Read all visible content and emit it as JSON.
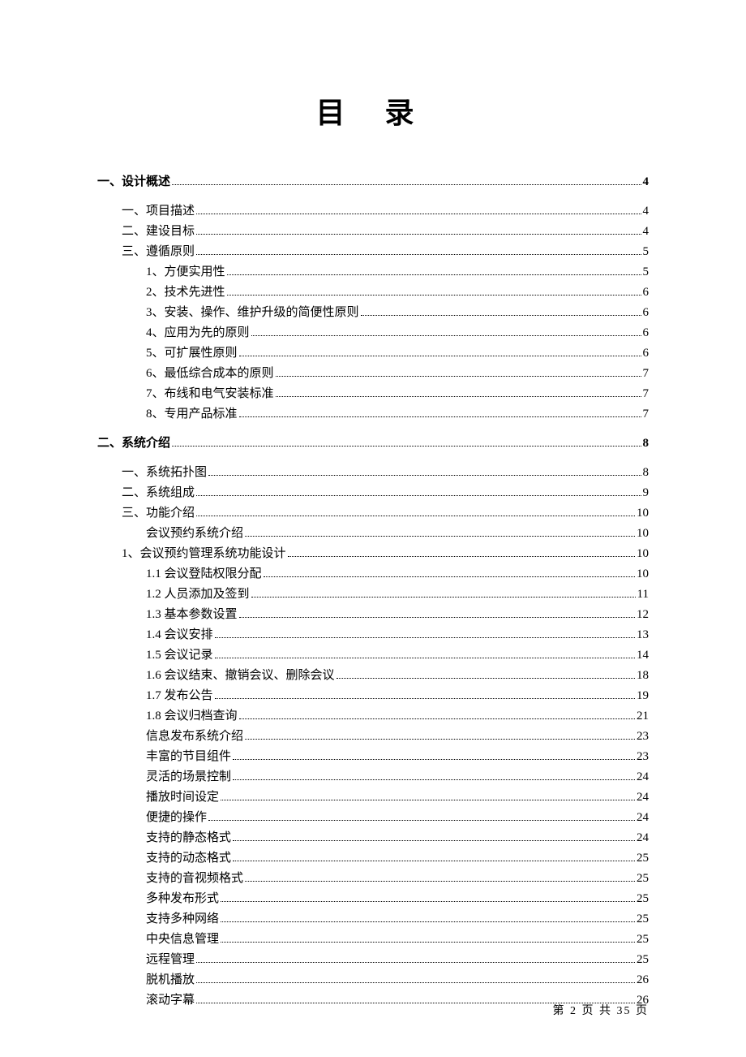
{
  "title": "目 录",
  "footer": {
    "prefix": "第",
    "page": "2",
    "middle": "页 共",
    "total": "35",
    "suffix": "页"
  },
  "toc": [
    {
      "label": "一、设计概述",
      "page": "4",
      "indent": 0,
      "bold": true,
      "gap": false
    },
    {
      "label": "一、项目描述",
      "page": "4",
      "indent": 1,
      "bold": false,
      "gap": true
    },
    {
      "label": "二、建设目标",
      "page": "4",
      "indent": 1,
      "bold": false,
      "gap": false
    },
    {
      "label": "三、遵循原则",
      "page": "5",
      "indent": 1,
      "bold": false,
      "gap": false
    },
    {
      "label": "1、方便实用性",
      "page": "5",
      "indent": 2,
      "bold": false,
      "gap": false
    },
    {
      "label": "2、技术先进性",
      "page": "6",
      "indent": 2,
      "bold": false,
      "gap": false
    },
    {
      "label": "3、安装、操作、维护升级的简便性原则",
      "page": "6",
      "indent": 2,
      "bold": false,
      "gap": false
    },
    {
      "label": "4、应用为先的原则",
      "page": "6",
      "indent": 2,
      "bold": false,
      "gap": false
    },
    {
      "label": "5、可扩展性原则",
      "page": "6",
      "indent": 2,
      "bold": false,
      "gap": false
    },
    {
      "label": "6、最低综合成本的原则",
      "page": "7",
      "indent": 2,
      "bold": false,
      "gap": false
    },
    {
      "label": "7、布线和电气安装标准",
      "page": "7",
      "indent": 2,
      "bold": false,
      "gap": false
    },
    {
      "label": "8、专用产品标准",
      "page": "7",
      "indent": 2,
      "bold": false,
      "gap": false
    },
    {
      "label": "二、系统介绍",
      "page": "8",
      "indent": 0,
      "bold": true,
      "gap": true
    },
    {
      "label": "一、系统拓扑图",
      "page": "8",
      "indent": 1,
      "bold": false,
      "gap": true
    },
    {
      "label": "二、系统组成",
      "page": "9",
      "indent": 1,
      "bold": false,
      "gap": false
    },
    {
      "label": "三、功能介绍",
      "page": "10",
      "indent": 1,
      "bold": false,
      "gap": false
    },
    {
      "label": "会议预约系统介绍",
      "page": "10",
      "indent": 2,
      "bold": false,
      "gap": false
    },
    {
      "label": "1、会议预约管理系统功能设计",
      "page": "10",
      "indent": 1,
      "bold": false,
      "gap": false
    },
    {
      "label": "1.1 会议登陆权限分配",
      "page": "10",
      "indent": 2,
      "bold": false,
      "gap": false
    },
    {
      "label": "1.2 人员添加及签到",
      "page": "11",
      "indent": 2,
      "bold": false,
      "gap": false
    },
    {
      "label": "1.3 基本参数设置",
      "page": "12",
      "indent": 2,
      "bold": false,
      "gap": false
    },
    {
      "label": "1.4 会议安排",
      "page": "13",
      "indent": 2,
      "bold": false,
      "gap": false
    },
    {
      "label": "1.5 会议记录",
      "page": "14",
      "indent": 2,
      "bold": false,
      "gap": false
    },
    {
      "label": "1.6 会议结束、撤销会议、删除会议",
      "page": "18",
      "indent": 2,
      "bold": false,
      "gap": false
    },
    {
      "label": "1.7 发布公告",
      "page": "19",
      "indent": 2,
      "bold": false,
      "gap": false
    },
    {
      "label": "1.8 会议归档查询",
      "page": "21",
      "indent": 2,
      "bold": false,
      "gap": false
    },
    {
      "label": "信息发布系统介绍",
      "page": "23",
      "indent": 2,
      "bold": false,
      "gap": false
    },
    {
      "label": "丰富的节目组件",
      "page": "23",
      "indent": 2,
      "bold": false,
      "gap": false
    },
    {
      "label": "灵活的场景控制",
      "page": "24",
      "indent": 2,
      "bold": false,
      "gap": false
    },
    {
      "label": "播放时间设定",
      "page": "24",
      "indent": 2,
      "bold": false,
      "gap": false
    },
    {
      "label": "便捷的操作",
      "page": "24",
      "indent": 2,
      "bold": false,
      "gap": false
    },
    {
      "label": "支持的静态格式",
      "page": "24",
      "indent": 2,
      "bold": false,
      "gap": false
    },
    {
      "label": "支持的动态格式",
      "page": "25",
      "indent": 2,
      "bold": false,
      "gap": false
    },
    {
      "label": "支持的音视频格式",
      "page": "25",
      "indent": 2,
      "bold": false,
      "gap": false
    },
    {
      "label": "多种发布形式",
      "page": "25",
      "indent": 2,
      "bold": false,
      "gap": false
    },
    {
      "label": "支持多种网络",
      "page": "25",
      "indent": 2,
      "bold": false,
      "gap": false
    },
    {
      "label": "中央信息管理",
      "page": "25",
      "indent": 2,
      "bold": false,
      "gap": false
    },
    {
      "label": "远程管理",
      "page": "25",
      "indent": 2,
      "bold": false,
      "gap": false
    },
    {
      "label": "脱机播放",
      "page": "26",
      "indent": 2,
      "bold": false,
      "gap": false
    },
    {
      "label": "滚动字幕",
      "page": "26",
      "indent": 2,
      "bold": false,
      "gap": false
    }
  ]
}
